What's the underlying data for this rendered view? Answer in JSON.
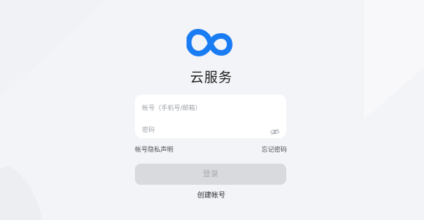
{
  "app": {
    "title": "云服务"
  },
  "form": {
    "account_placeholder": "帐号（手机号/邮箱）",
    "password_placeholder": "密码"
  },
  "links": {
    "privacy": "帐号隐私声明",
    "forgot": "忘记密码"
  },
  "actions": {
    "login": "登录",
    "create": "创建帐号"
  },
  "icons": {
    "logo": "infinity-cloud-logo-icon",
    "password_visibility": "eye-off-icon"
  },
  "colors": {
    "brand": "#1a7cf3",
    "login_disabled_bg": "#d9dadd",
    "page_bg": "#f3f4f7"
  }
}
